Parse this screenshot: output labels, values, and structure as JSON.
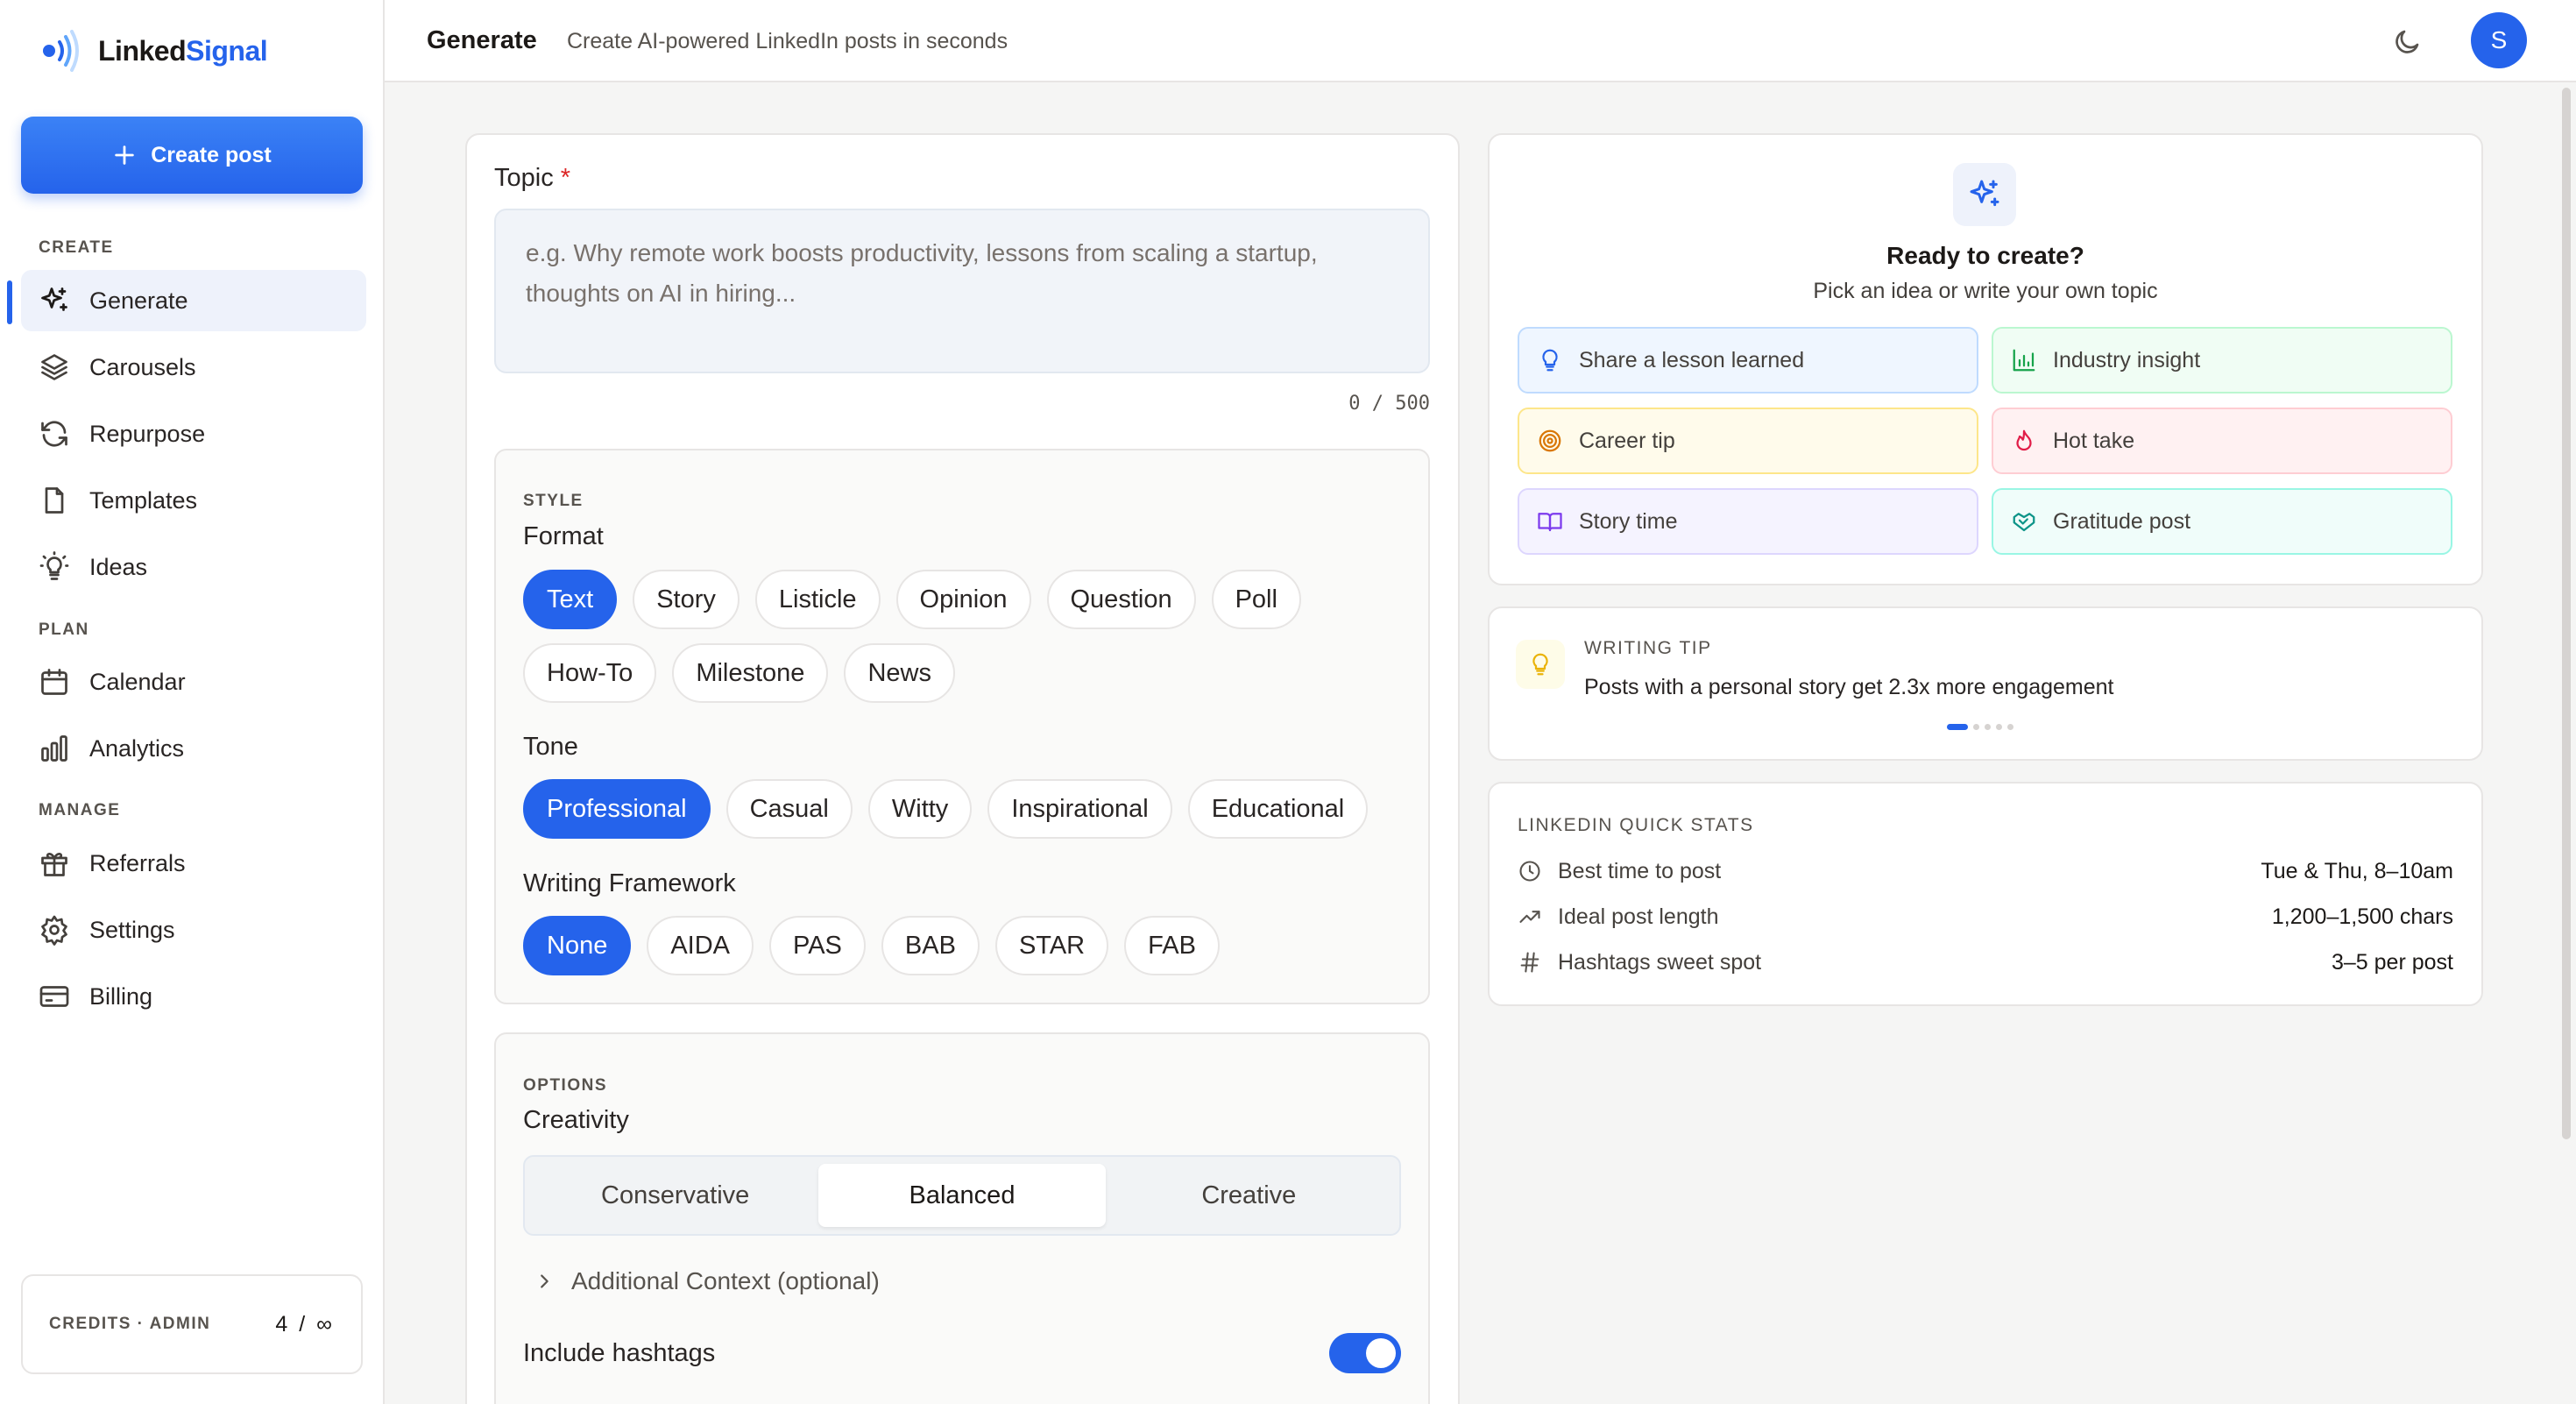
{
  "app": {
    "brand_part1": "Linked",
    "brand_part2": "Signal"
  },
  "sidebar": {
    "create_button": "Create post",
    "sections": {
      "create": "CREATE",
      "plan": "PLAN",
      "manage": "MANAGE"
    },
    "items": [
      {
        "label": "Generate",
        "icon": "sparkles-icon"
      },
      {
        "label": "Carousels",
        "icon": "layers-icon"
      },
      {
        "label": "Repurpose",
        "icon": "refresh-icon"
      },
      {
        "label": "Templates",
        "icon": "file-icon"
      },
      {
        "label": "Ideas",
        "icon": "lightbulb-icon"
      },
      {
        "label": "Calendar",
        "icon": "calendar-icon"
      },
      {
        "label": "Analytics",
        "icon": "bar-chart-icon"
      },
      {
        "label": "Referrals",
        "icon": "gift-icon"
      },
      {
        "label": "Settings",
        "icon": "gear-icon"
      },
      {
        "label": "Billing",
        "icon": "credit-card-icon"
      }
    ],
    "credits": {
      "label": "CREDITS · ADMIN",
      "value": "4 / ∞"
    }
  },
  "header": {
    "title": "Generate",
    "subtitle": "Create AI-powered LinkedIn posts in seconds",
    "avatar": "S"
  },
  "form": {
    "topic_label": "Topic",
    "required_mark": "*",
    "topic_placeholder": "e.g. Why remote work boosts productivity, lessons from scaling a startup, thoughts on AI in hiring...",
    "counter": "0 / 500",
    "style": {
      "section": "STYLE",
      "format_label": "Format",
      "formats": [
        "Text",
        "Story",
        "Listicle",
        "Opinion",
        "Question",
        "Poll",
        "How-To",
        "Milestone",
        "News"
      ],
      "format_selected": "Text",
      "tone_label": "Tone",
      "tones": [
        "Professional",
        "Casual",
        "Witty",
        "Inspirational",
        "Educational"
      ],
      "tone_selected": "Professional",
      "framework_label": "Writing Framework",
      "frameworks": [
        "None",
        "AIDA",
        "PAS",
        "BAB",
        "STAR",
        "FAB"
      ],
      "framework_selected": "None"
    },
    "options": {
      "section": "OPTIONS",
      "creativity_label": "Creativity",
      "creativity": [
        "Conservative",
        "Balanced",
        "Creative"
      ],
      "creativity_selected": "Balanced",
      "additional": "Additional Context (optional)",
      "hashtags_label": "Include hashtags",
      "hashtags_on": true
    }
  },
  "ready": {
    "title": "Ready to create?",
    "subtitle": "Pick an idea or write your own topic",
    "ideas": [
      {
        "label": "Share a lesson learned",
        "icon": "lightbulb-icon",
        "color": "#2563eb"
      },
      {
        "label": "Industry insight",
        "icon": "bar-chart-icon",
        "color": "#16a34a"
      },
      {
        "label": "Career tip",
        "icon": "target-icon",
        "color": "#d97706"
      },
      {
        "label": "Hot take",
        "icon": "flame-icon",
        "color": "#e11d48"
      },
      {
        "label": "Story time",
        "icon": "book-icon",
        "color": "#7c3aed"
      },
      {
        "label": "Gratitude post",
        "icon": "handshake-icon",
        "color": "#0d9488"
      }
    ]
  },
  "tip": {
    "heading": "WRITING TIP",
    "text": "Posts with a personal story get 2.3x more engagement"
  },
  "stats": {
    "heading": "LINKEDIN QUICK STATS",
    "rows": [
      {
        "label": "Best time to post",
        "value": "Tue & Thu, 8–10am",
        "icon": "clock-icon"
      },
      {
        "label": "Ideal post length",
        "value": "1,200–1,500 chars",
        "icon": "trending-icon"
      },
      {
        "label": "Hashtags sweet spot",
        "value": "3–5 per post",
        "icon": "hash-icon"
      }
    ]
  }
}
